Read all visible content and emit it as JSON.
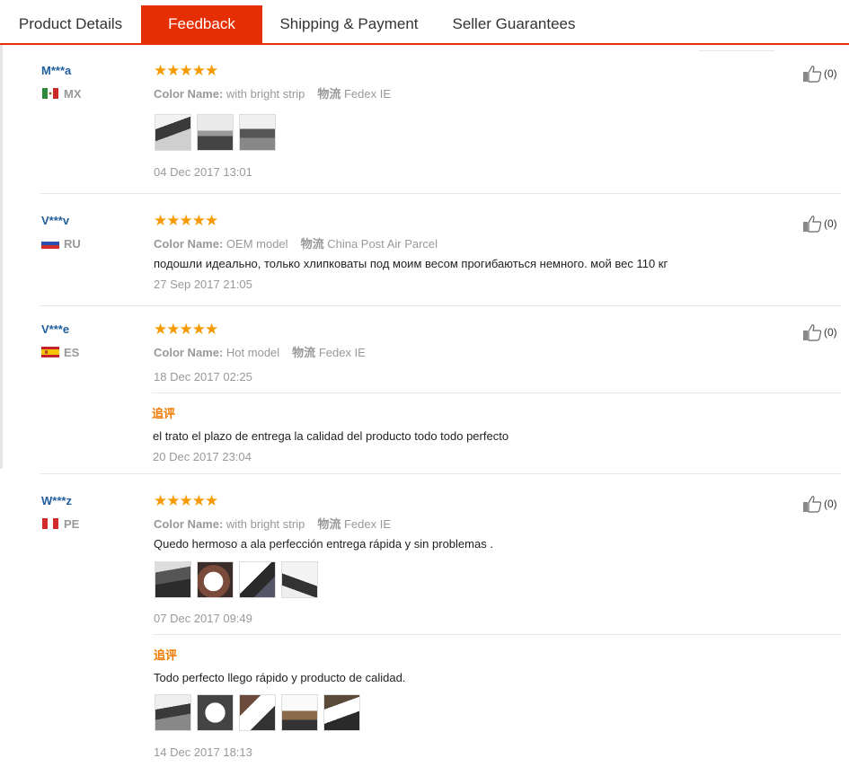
{
  "tabs": [
    {
      "label": "Product Details",
      "active": false
    },
    {
      "label": "Feedback",
      "active": true
    },
    {
      "label": "Shipping & Payment",
      "active": false
    },
    {
      "label": "Seller Guarantees",
      "active": false
    }
  ],
  "colors": {
    "accent": "#e62e04",
    "star": "#f59a00",
    "username": "#1f5e9c",
    "followup": "#f07a00"
  },
  "reviews": [
    {
      "user": "M***a",
      "country": "MX",
      "flag_icon": "mexico-flag-icon",
      "stars": "★★★★★",
      "color_key": "Color Name:",
      "color_value": "with bright strip",
      "shipping_key": "物流",
      "shipping_value": "Fedex IE",
      "text": "",
      "photo_count": 3,
      "date": "04 Dec 2017 13:01",
      "likes": "(0)"
    },
    {
      "user": "V***v",
      "country": "RU",
      "flag_icon": "russia-flag-icon",
      "stars": "★★★★★",
      "color_key": "Color Name:",
      "color_value": "OEM model",
      "shipping_key": "物流",
      "shipping_value": "China Post Air Parcel",
      "text": "подошли идеально, только хлипковаты под моим весом прогибаються немного. мой вес 110 кг",
      "date": "27 Sep 2017 21:05",
      "likes": "(0)"
    },
    {
      "user": "V***e",
      "country": "ES",
      "flag_icon": "spain-flag-icon",
      "stars": "★★★★★",
      "color_key": "Color Name:",
      "color_value": "Hot model",
      "shipping_key": "物流",
      "shipping_value": "Fedex IE",
      "date": "18 Dec 2017 02:25",
      "likes": "(0)",
      "followup_label": "追评",
      "followup_text": "el trato el plazo de entrega la calidad del producto todo todo perfecto",
      "followup_date": "20 Dec 2017 23:04"
    },
    {
      "user": "W***z",
      "country": "PE",
      "flag_icon": "peru-flag-icon",
      "stars": "★★★★★",
      "color_key": "Color Name:",
      "color_value": "with bright strip",
      "shipping_key": "物流",
      "shipping_value": "Fedex IE",
      "text": "Quedo hermoso a ala perfección entrega rápida y sin problemas .",
      "photo_count": 4,
      "date": "07 Dec 2017 09:49",
      "likes": "(0)",
      "followup_label": "追评",
      "followup_text": "Todo perfecto llego rápido y producto de calidad.",
      "followup_photo_count": 5,
      "followup_date": "14 Dec 2017 18:13"
    }
  ]
}
